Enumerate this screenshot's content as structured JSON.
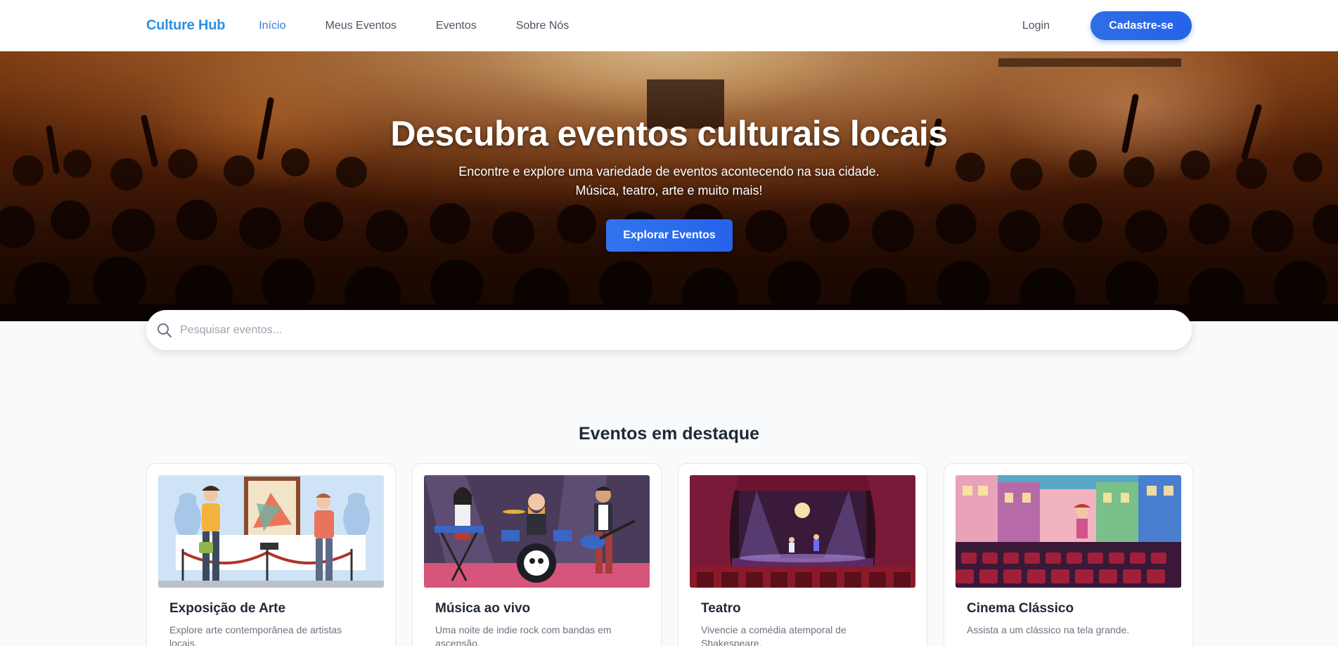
{
  "navbar": {
    "logo": "Culture Hub",
    "links": [
      {
        "label": "Início",
        "active": true
      },
      {
        "label": "Meus Eventos",
        "active": false
      },
      {
        "label": "Eventos",
        "active": false
      },
      {
        "label": "Sobre Nós",
        "active": false
      }
    ],
    "login_label": "Login",
    "signup_label": "Cadastre-se"
  },
  "hero": {
    "title": "Descubra eventos culturais locais",
    "subtitle_line1": "Encontre e explore uma variedade de eventos acontecendo na sua cidade.",
    "subtitle_line2": "Música, teatro, arte e muito mais!",
    "cta_label": "Explorar Eventos"
  },
  "search": {
    "placeholder": "Pesquisar eventos..."
  },
  "featured": {
    "title": "Eventos em destaque",
    "cards": [
      {
        "title": "Exposição de Arte",
        "description": "Explore arte contemporânea de artistas locais."
      },
      {
        "title": "Música ao vivo",
        "description": "Uma noite de indie rock com bandas em ascensão."
      },
      {
        "title": "Teatro",
        "description": "Vivencie a comédia atemporal de Shakespeare."
      },
      {
        "title": "Cinema Clássico",
        "description": "Assista a um clássico na tela grande."
      }
    ]
  },
  "colors": {
    "accent": "#2563eb",
    "logo": "#2f8fe0"
  }
}
